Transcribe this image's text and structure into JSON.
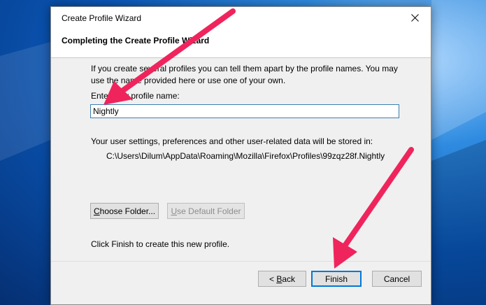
{
  "window": {
    "title": "Create Profile Wizard"
  },
  "header": {
    "title": "Completing the Create Profile Wizard"
  },
  "content": {
    "intro": "If you create several profiles you can tell them apart by the profile names. You may use the name provided here or use one of your own.",
    "name_label": "Enter new profile name:",
    "name_value": "Nightly",
    "storage_label": "Your user settings, preferences and other user-related data will be stored in:",
    "storage_path": "C:\\Users\\Dilum\\AppData\\Roaming\\Mozilla\\Firefox\\Profiles\\99zqz28f.Nightly",
    "choose_folder_pre": "",
    "choose_folder_u": "C",
    "choose_folder_post": "hoose Folder...",
    "default_folder_pre": "",
    "default_folder_u": "U",
    "default_folder_post": "se Default Folder",
    "finish_hint": "Click Finish to create this new profile."
  },
  "buttons": {
    "back_pre": "< ",
    "back_u": "B",
    "back_post": "ack",
    "finish": "Finish",
    "cancel": "Cancel"
  },
  "colors": {
    "annotation_arrow": "#f0245c",
    "focus_border": "#0078d7",
    "desktop_blue": "#0a57b8"
  },
  "icons": {
    "close": "close-icon"
  }
}
